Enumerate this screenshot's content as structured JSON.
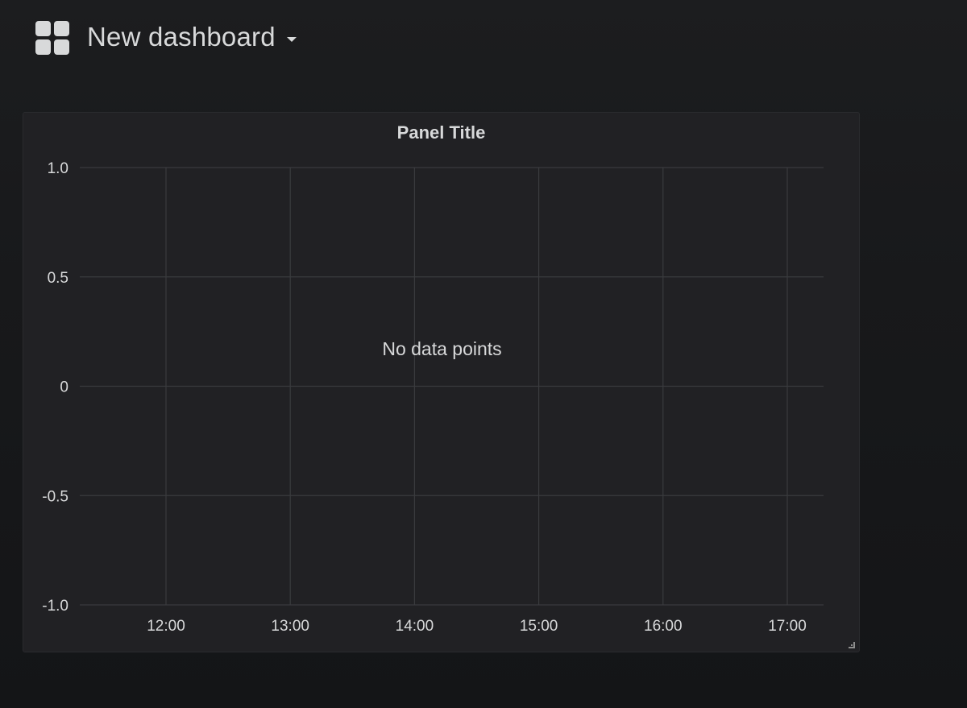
{
  "navbar": {
    "dashboard_title": "New dashboard",
    "icon": "dashboard-grid-icon",
    "caret_icon": "caret-down-icon"
  },
  "panel": {
    "title": "Panel Title",
    "empty_message": "No data points",
    "resize_icon": "resize-handle-icon"
  },
  "colors": {
    "background": "#161719",
    "panel": "#212124",
    "grid": "#3a3b3e",
    "text": "#d8d9da"
  },
  "chart_data": {
    "type": "line",
    "series": [],
    "x": [
      "12:00",
      "13:00",
      "14:00",
      "15:00",
      "16:00",
      "17:00"
    ],
    "y_ticks": [
      "1.0",
      "0.5",
      "0",
      "-0.5",
      "-1.0"
    ],
    "ylim": [
      -1.0,
      1.0
    ],
    "grid": true,
    "legend": "none"
  }
}
